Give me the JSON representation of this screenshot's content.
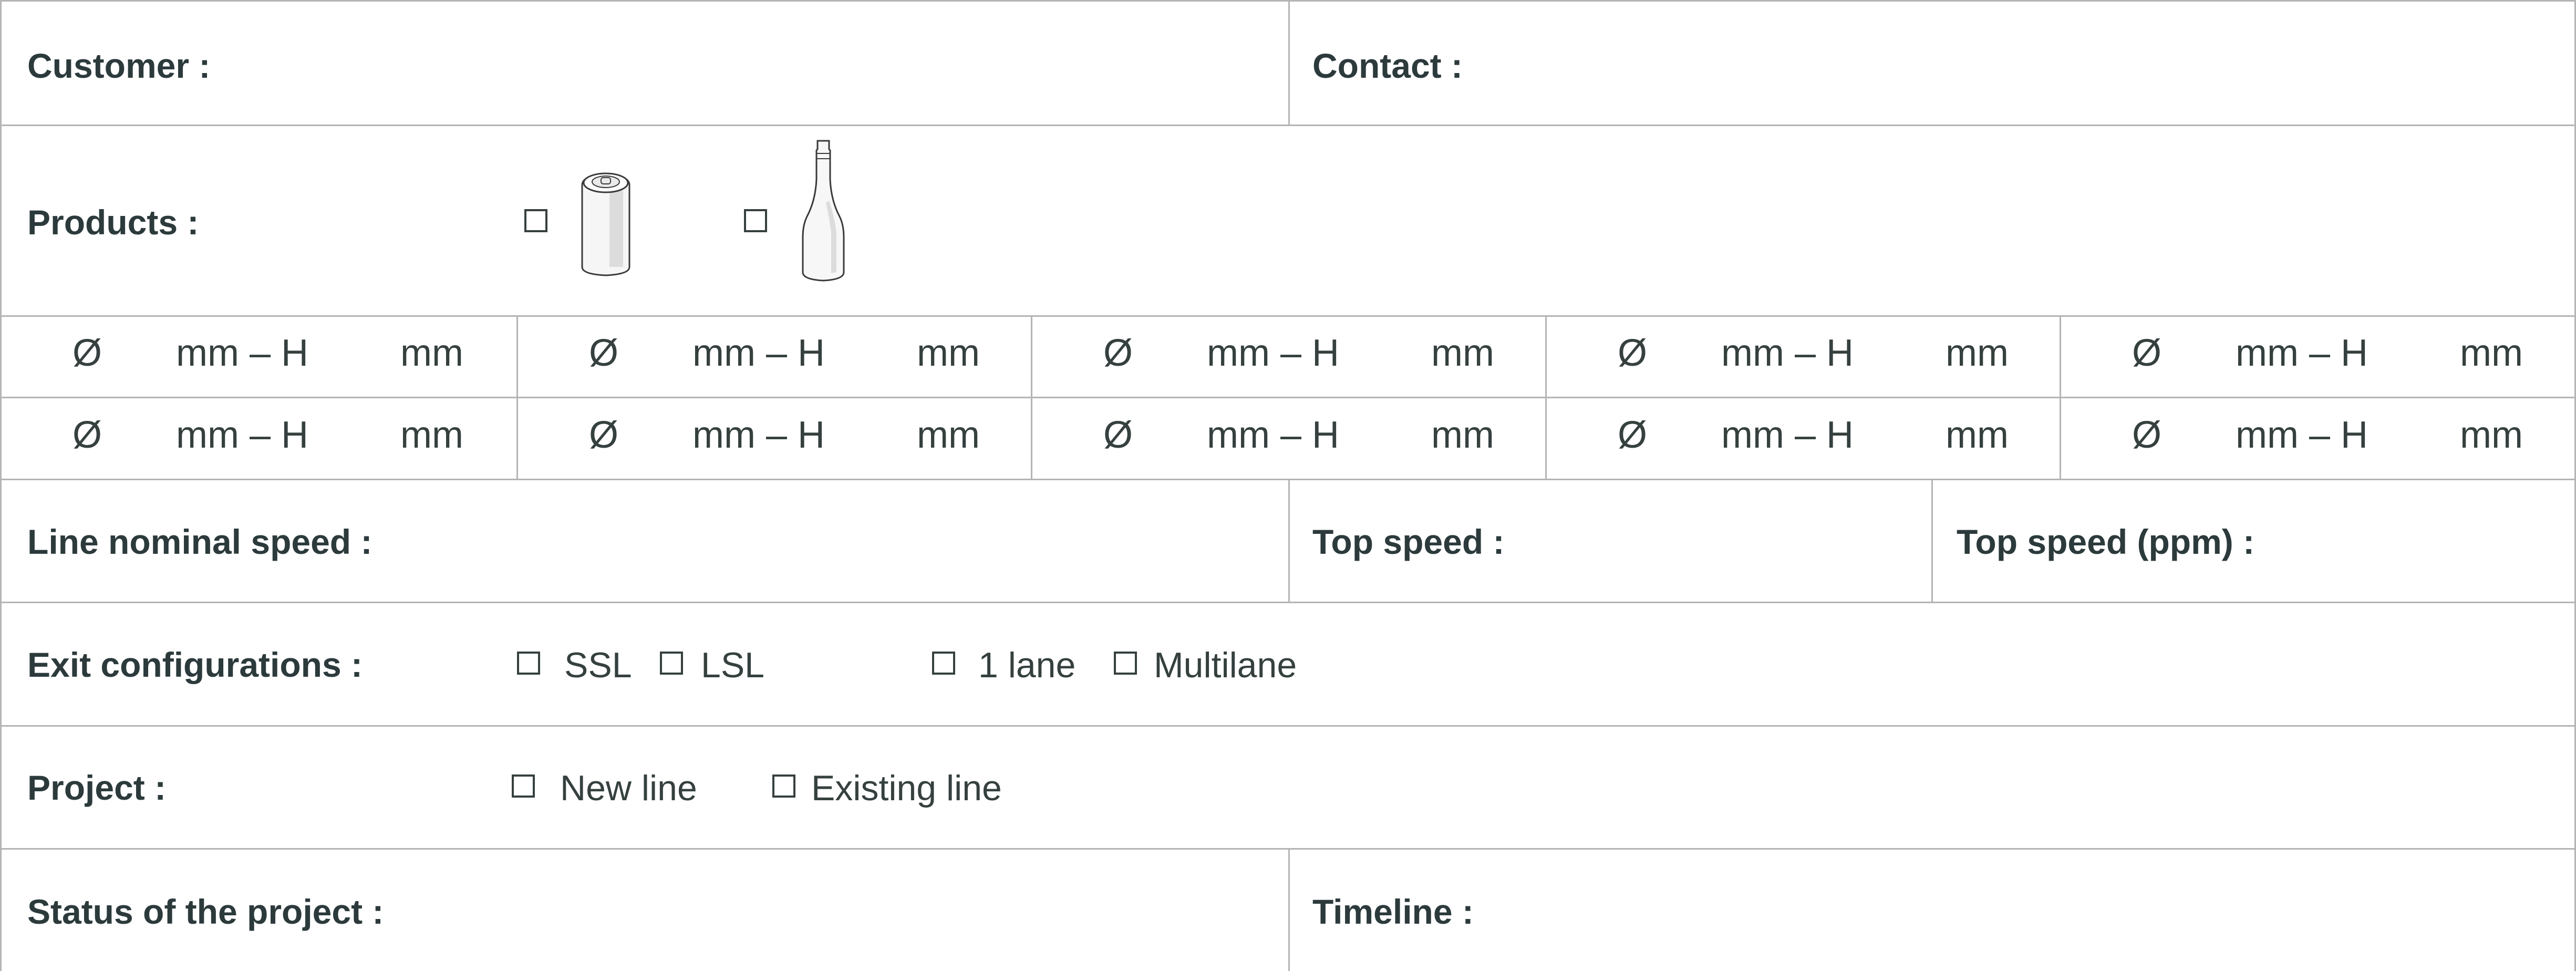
{
  "customer": {
    "label": "Customer :"
  },
  "contact": {
    "label": "Contact :"
  },
  "products": {
    "label": "Products :",
    "options": [
      "can",
      "bottle"
    ]
  },
  "dimensions": {
    "diameter_symbol": "Ø",
    "mid": "mm – H",
    "end": "mm"
  },
  "line_speed": {
    "nominal_label": "Line nominal speed :",
    "top_label": "Top speed :",
    "top_ppm_label": "Top speed (ppm) :"
  },
  "exit_config": {
    "label": "Exit configurations :",
    "options": [
      "SSL",
      "LSL",
      "1 lane",
      "Multilane"
    ]
  },
  "project": {
    "label": "Project :",
    "options": [
      "New line",
      "Existing line"
    ]
  },
  "status": {
    "label": "Status of the project :"
  },
  "timeline": {
    "label": "Timeline :"
  }
}
